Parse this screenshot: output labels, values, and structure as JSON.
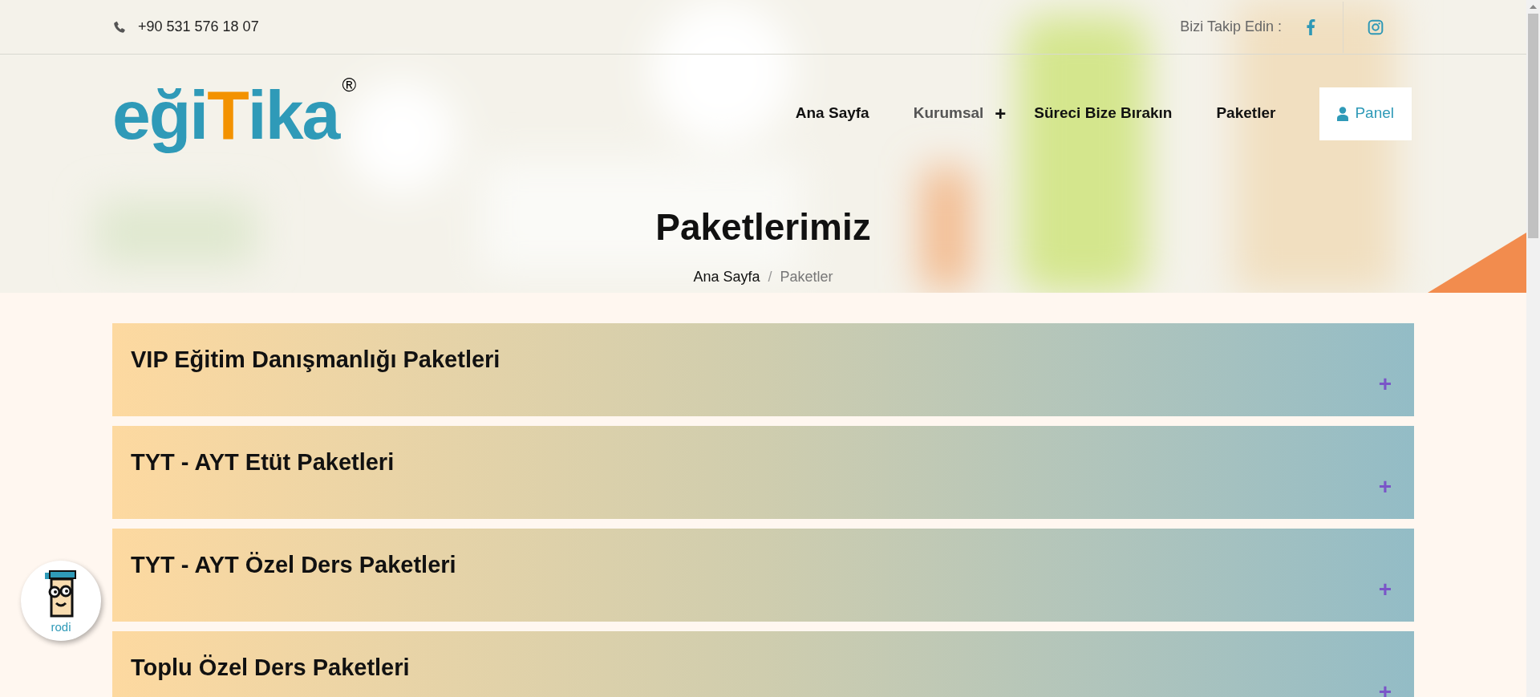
{
  "top_bar": {
    "phone": "+90 531 576 18 07",
    "follow_label": "Bizi Takip Edin :"
  },
  "logo": {
    "parts": [
      {
        "text": "eği",
        "kind": "plain"
      },
      {
        "text": "T",
        "kind": "accent"
      },
      {
        "text": "ika",
        "kind": "plain"
      }
    ],
    "mark": "®"
  },
  "nav": [
    {
      "label": "Ana Sayfa",
      "selected": false,
      "has_submenu": false
    },
    {
      "label": "Kurumsal",
      "selected": true,
      "has_submenu": true,
      "submenu_sign": "+"
    },
    {
      "label": "Süreci Bize Bırakın",
      "selected": false,
      "has_submenu": false
    },
    {
      "label": "Paketler",
      "selected": false,
      "has_submenu": false
    }
  ],
  "panel_button": "Panel",
  "hero": {
    "title": "Paketlerimiz",
    "breadcrumb": [
      "Ana Sayfa",
      "Paketler"
    ],
    "separator": "/"
  },
  "packages": [
    {
      "title": "VIP Eğitim Danışmanlığı Paketleri",
      "expanded": false,
      "sign": "+"
    },
    {
      "title": "TYT - AYT Etüt Paketleri",
      "expanded": false,
      "sign": "+"
    },
    {
      "title": "TYT - AYT Özel Ders Paketleri",
      "expanded": false,
      "sign": "+"
    },
    {
      "title": "Toplu Özel Ders Paketleri",
      "expanded": false,
      "sign": "+"
    }
  ],
  "chat_widget": {
    "label": "rodi"
  }
}
